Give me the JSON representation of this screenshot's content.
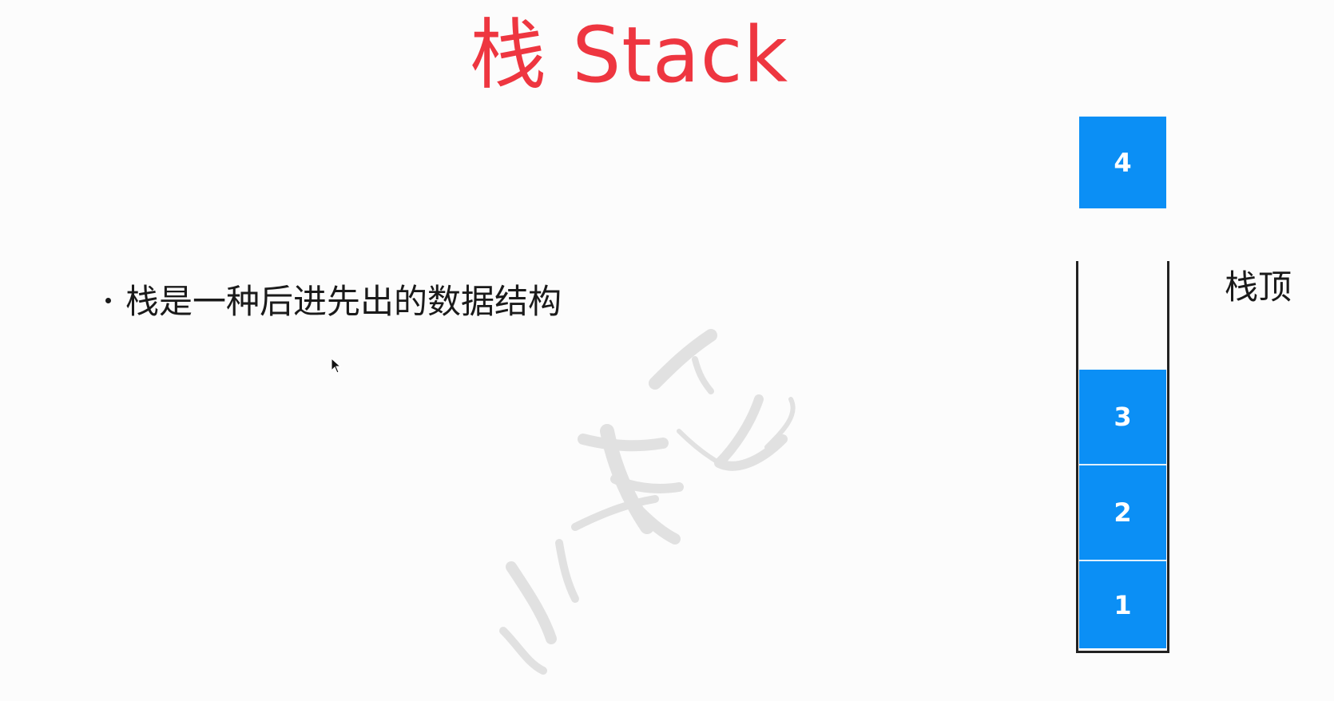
{
  "slide": {
    "title": "栈 Stack",
    "bullet": "栈是一种后进先出的数据结构"
  },
  "diagram": {
    "floating_block": "4",
    "stack_top_label": "栈顶",
    "stack_items": [
      "3",
      "2",
      "1"
    ]
  },
  "colors": {
    "title": "#ee3640",
    "block": "#0b8ff5",
    "text": "#1a1a1a",
    "border": "#222222"
  },
  "icons": {
    "cursor": "mouse-pointer-icon",
    "watermark": "calligraphy-watermark-icon"
  }
}
